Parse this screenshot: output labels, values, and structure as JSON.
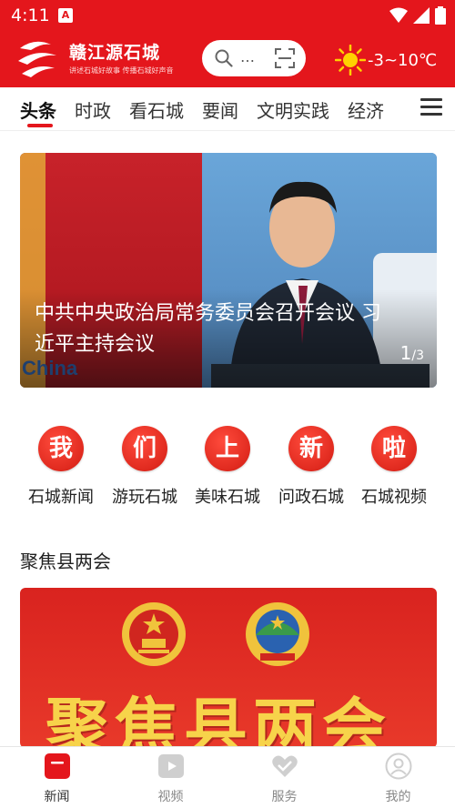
{
  "status_bar": {
    "time": "4:11",
    "app_icon": "A"
  },
  "header": {
    "brand_name": "赣江源石城",
    "brand_slogan": "讲述石城好故事 传播石城好声音",
    "search_placeholder": "…",
    "weather": {
      "icon": "sun-icon",
      "temperature": "-3~10℃"
    }
  },
  "tabs": [
    "头条",
    "时政",
    "看石城",
    "要闻",
    "文明实践",
    "经济"
  ],
  "active_tab": "头条",
  "banner": {
    "headline": "中共中央政治局常务委员会召开会议 习近平主持会议",
    "background_text": "China",
    "pager_current": "1",
    "pager_total": "/3"
  },
  "quick_entries": [
    {
      "glyph": "我",
      "label": "石城新闻"
    },
    {
      "glyph": "们",
      "label": "游玩石城"
    },
    {
      "glyph": "上",
      "label": "美味石城"
    },
    {
      "glyph": "新",
      "label": "问政石城"
    },
    {
      "glyph": "啦",
      "label": "石城视频"
    }
  ],
  "section": {
    "title": "聚焦县两会",
    "feature_text": "聚焦县两会"
  },
  "bottom_nav": [
    {
      "label": "新闻",
      "icon": "news-icon",
      "active": true
    },
    {
      "label": "视频",
      "icon": "video-icon",
      "active": false
    },
    {
      "label": "服务",
      "icon": "service-icon",
      "active": false
    },
    {
      "label": "我的",
      "icon": "profile-icon",
      "active": false
    }
  ],
  "colors": {
    "brand_red": "#e4161c",
    "gold": "#f7d34a",
    "muted": "#888888"
  }
}
